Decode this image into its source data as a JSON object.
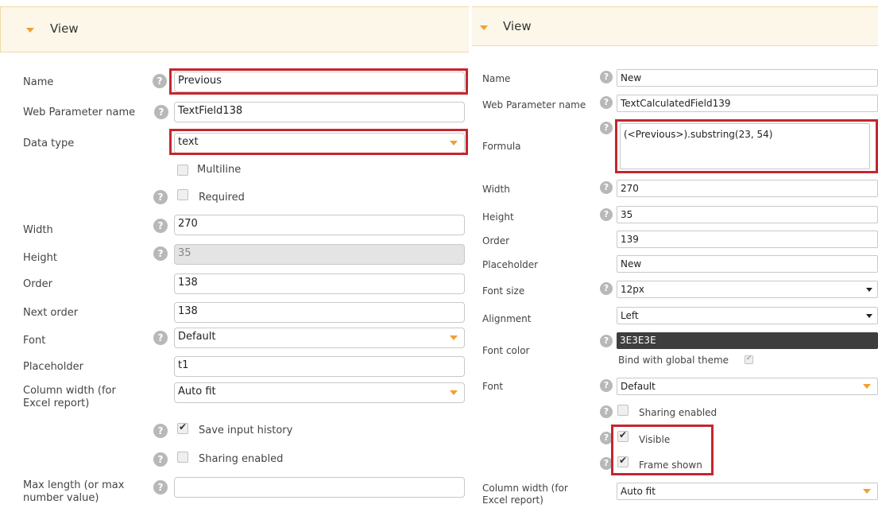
{
  "left": {
    "header_title": "View",
    "name_label": "Name",
    "name_value": "Previous",
    "web_param_label": "Web Parameter name",
    "web_param_value": "TextField138",
    "data_type_label": "Data type",
    "data_type_value": "text",
    "multiline_label": "Multiline",
    "required_label": "Required",
    "width_label": "Width",
    "width_value": "270",
    "height_label": "Height",
    "height_value": "35",
    "order_label": "Order",
    "order_value": "138",
    "next_order_label": "Next order",
    "next_order_value": "138",
    "font_label": "Font",
    "font_value": "Default",
    "placeholder_label": "Placeholder",
    "placeholder_value": "t1",
    "column_width_label_1": "Column width (for",
    "column_width_label_2": "Excel report)",
    "column_width_value": "Auto fit",
    "save_history_label": "Save input history",
    "sharing_label": "Sharing enabled",
    "max_length_label_1": "Max length (or max",
    "max_length_label_2": "number value)",
    "max_length_value": ""
  },
  "right": {
    "header_title": "View",
    "name_label": "Name",
    "name_value": "New",
    "web_param_label": "Web Parameter name",
    "web_param_value": "TextCalculatedField139",
    "formula_label": "Formula",
    "formula_value": "(<Previous>).substring(23, 54)",
    "width_label": "Width",
    "width_value": "270",
    "height_label": "Height",
    "height_value": "35",
    "order_label": "Order",
    "order_value": "139",
    "placeholder_label": "Placeholder",
    "placeholder_value": "New",
    "font_size_label": "Font size",
    "font_size_value": "12px",
    "alignment_label": "Alignment",
    "alignment_value": "Left",
    "font_color_label": "Font color",
    "font_color_value": "3E3E3E",
    "bind_theme_label": "Bind with global theme",
    "font_label": "Font",
    "font_value": "Default",
    "sharing_label": "Sharing enabled",
    "visible_label": "Visible",
    "frame_label": "Frame shown",
    "column_width_label_1": "Column width (for",
    "column_width_label_2": "Excel report)",
    "column_width_value": "Auto fit"
  },
  "icons": {
    "help": "?",
    "header_toggle": "triangle-down",
    "select": "triangle-down"
  },
  "colors": {
    "highlight": "#c4262e",
    "header_bg": "#fcf7e9",
    "accent_arrow": "#f0a030",
    "font_color_swatch": "#3e3e3e"
  }
}
